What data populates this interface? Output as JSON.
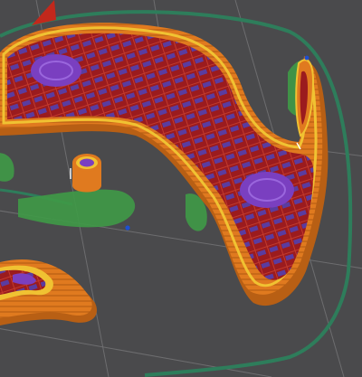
{
  "viewport": {
    "background": "#4a4a4c",
    "grid_line_color": "#8a8a8c",
    "colors": {
      "skirt": "#2e7d5b",
      "support": "#3f9a47",
      "outer_wall": "#e07a1f",
      "outer_wall_shadow": "#b85f14",
      "inner_wall": "#f0c232",
      "infill": "#9b1b1e",
      "top_surface": "#7a3fc0",
      "travel": "#ffffff",
      "marker": "#1d4fd0",
      "cone": "#c2281c"
    },
    "legend": []
  }
}
